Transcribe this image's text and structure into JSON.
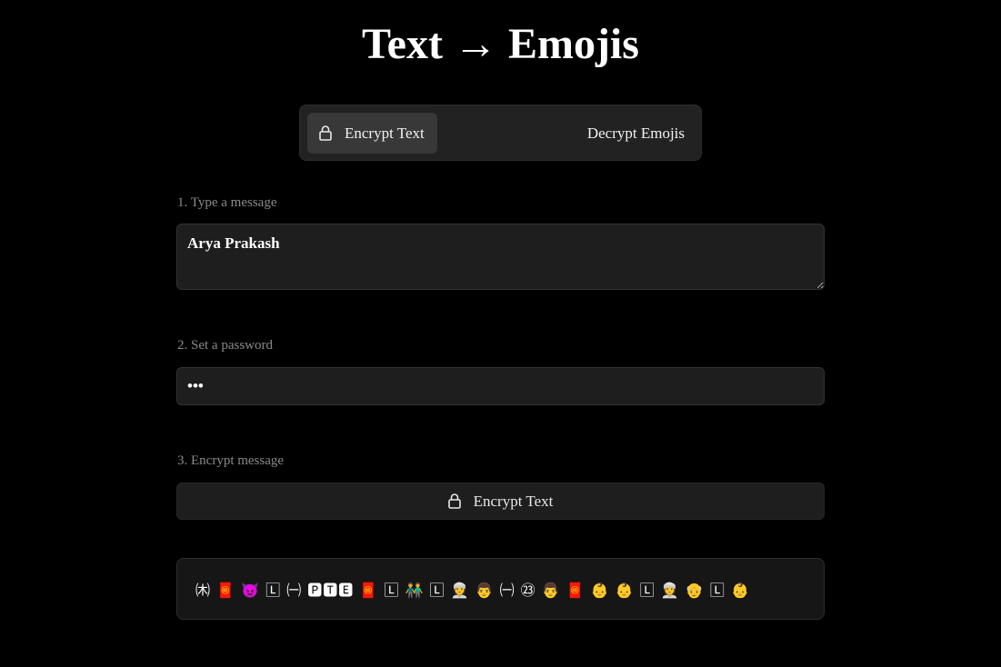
{
  "app": {
    "title": "Text → Emojis"
  },
  "mode_switch": {
    "encrypt_tab_label": "Encrypt Text",
    "decrypt_tab_label": "Decrypt Emojis",
    "active": "encrypt"
  },
  "steps": {
    "message_label": "1. Type a message",
    "password_label": "2. Set a password",
    "encrypt_label": "3. Encrypt message"
  },
  "message_input": {
    "value": "Arya Prakash",
    "placeholder": ""
  },
  "password_input": {
    "value": "abc",
    "type": "password"
  },
  "encrypt_button": {
    "label": "Encrypt Text",
    "icon": "lock-icon"
  },
  "output": {
    "value": "㈭ 🧧 👿 🄻 ㈠ 🅿🆃🅴 🧧 🄻 👬 🄻 👳 👨 ㈠ ㉓ 👨 🧧 👶 👶 🄻 👳 👴 🄻 👶"
  },
  "colors": {
    "background": "#000000",
    "panel": "#1e1e1e",
    "active_tab": "#383838",
    "muted_text": "#8a8a8a"
  }
}
